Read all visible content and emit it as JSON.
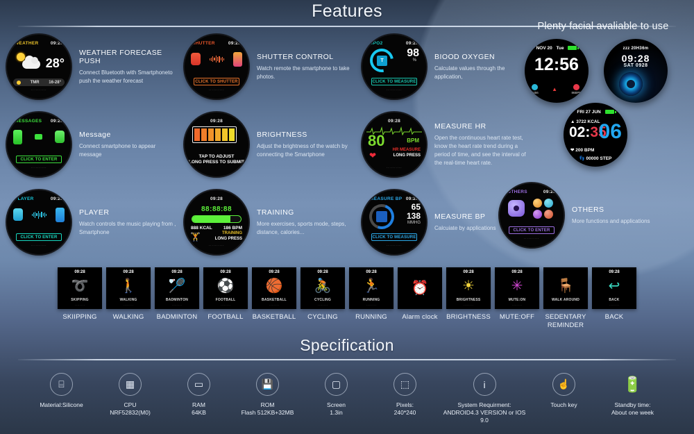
{
  "sections": {
    "features_title": "Features",
    "spec_title": "Specification",
    "facial_title": "Plenty facial avaliable to use"
  },
  "features": [
    {
      "id": "weather",
      "title": "WEATHER FORECASE PUSH",
      "desc": "Connect Bluetooth with Smartphoneto push the weather forecast",
      "watch": {
        "label": "WEATHER",
        "label_color": "#e8c02a",
        "time": "09:28",
        "value": "28°",
        "sub_left": "TMR",
        "sub_right": "16-28°"
      }
    },
    {
      "id": "shutter",
      "title": "SHUTTER CONTROL",
      "desc": "Watch remote the smartphone to take photos.",
      "watch": {
        "label": "SHUTTER",
        "label_color": "#e8552a",
        "time": "09:28",
        "button": "CLICK TO SHUTTER",
        "button_color": "#e8722a"
      }
    },
    {
      "id": "blood-oxygen",
      "title": "BIOOD OXYGEN",
      "desc": "Calculate values through the application,",
      "watch": {
        "label": "SPO2",
        "label_color": "#17c4bd",
        "time": "09:28",
        "value": "98",
        "unit": "%",
        "button": "CLICK TO MEASURE",
        "button_color": "#18c8b0"
      }
    },
    {
      "id": "message",
      "title": "Message",
      "desc": "Connect smartphone to appear message",
      "watch": {
        "label": "MESSAGES",
        "label_color": "#3ce03c",
        "time": "09:28",
        "button": "CLICK TO ENTER",
        "button_color": "#3ce03c"
      }
    },
    {
      "id": "brightness",
      "title": "BRIGHTNESS",
      "desc": "Adjust the brightness of the watch by connecting the Smartphone",
      "watch": {
        "label": "",
        "time": "09:28",
        "hint_line1": "TAP TO ADJUST",
        "hint_line2": "LONG PRESS TO SUBMIT"
      }
    },
    {
      "id": "measure-hr",
      "title": "MEASURE HR",
      "desc": "Open the continuous heart rate test, know the heart rate trend during a period of time, and see the interval of the real-time heart rate.",
      "watch": {
        "label": "",
        "time": "09:28",
        "value": "80",
        "unit": "BPM",
        "hint_line1": "HR MEASURE",
        "hint_line2": "LONG PRESS"
      }
    },
    {
      "id": "player",
      "title": "PLAYER",
      "desc": "Watch controls the music playing from ,  Smartphone",
      "watch": {
        "label": "PLAYER",
        "label_color": "#17c4d8",
        "time": "09:28",
        "button": "CLICK TO ENTER",
        "button_color": "#17d8c0"
      }
    },
    {
      "id": "training",
      "title": "TRAINING",
      "desc": "More exercises, sports mode, steps, distance, calories...",
      "watch": {
        "label": "",
        "time": "09:28",
        "value": "88:88:88",
        "stat_left": "888 KCAL",
        "stat_right": "186 BPM",
        "hint_line1": "TRAINING",
        "hint_line2": "LONG PRESS"
      }
    },
    {
      "id": "measure-bp",
      "title": "MEASURE BP",
      "desc": "Calcuiate by applications",
      "watch": {
        "label": "MEASURE BP",
        "label_color": "#2ba8e8",
        "time": "09:28",
        "value_top": "65",
        "value_bottom": "138",
        "unit": "MMHG",
        "button": "CLICK TO MEASURE",
        "button_color": "#2ba8e8"
      }
    },
    {
      "id": "others",
      "title": "OTHERS",
      "desc": "More functions and applications",
      "watch": {
        "label": "OTHERS",
        "label_color": "#9b6ee0",
        "time": "09:28",
        "button": "CLICK TO ENTER",
        "button_color": "#9b6ee0"
      }
    }
  ],
  "facial_faces": [
    {
      "id": "face-digital",
      "date": "NOV 20",
      "weekday": "Tue",
      "time": "12:56",
      "stat_steps": "3456",
      "stat_bpm": "86BPM"
    },
    {
      "id": "face-space",
      "sleep": "zzz 20H36m",
      "time": "09:28",
      "date": "SAT 0928"
    },
    {
      "id": "face-sport",
      "date": "FRI 27 JUN",
      "kcal": "3722 KCAL",
      "time_left": "02:",
      "time_mid": "35",
      "time_right": "06",
      "bpm": "200 BPM",
      "steps": "00000 STEP"
    }
  ],
  "sports": [
    {
      "id": "skipping",
      "tile_time": "09:28",
      "tile_name": "SKIPPING",
      "label": "SKIIPPING",
      "glyph": "➰",
      "color": "#c448d8"
    },
    {
      "id": "walking",
      "tile_time": "09:28",
      "tile_name": "WALKING",
      "label": "WALKING",
      "glyph": "🚶",
      "color": "#e8e8e8"
    },
    {
      "id": "badminton",
      "tile_time": "09:28",
      "tile_name": "BADMINTON",
      "label": "BADMINTON",
      "glyph": "🏸",
      "color": "#f0f0f0"
    },
    {
      "id": "football",
      "tile_time": "09:28",
      "tile_name": "FOOTBALL",
      "label": "FOOTBALL",
      "glyph": "⚽",
      "color": "#ffffff"
    },
    {
      "id": "basketball",
      "tile_time": "09:28",
      "tile_name": "BASKETBALL",
      "label": "BASKETBALL",
      "glyph": "🏀",
      "color": "#e2722a"
    },
    {
      "id": "cycling",
      "tile_time": "09:28",
      "tile_name": "CYCLING",
      "label": "CYCLING",
      "glyph": "🚴",
      "color": "#e8984a"
    },
    {
      "id": "running",
      "tile_time": "09:28",
      "tile_name": "RUNNING",
      "label": "RUNNING",
      "glyph": "🏃",
      "color": "#3a5ce0"
    },
    {
      "id": "alarm",
      "tile_time": "",
      "tile_name": "",
      "label": "Alarm clock",
      "glyph": "⏰",
      "color": "#dddddd"
    },
    {
      "id": "brightness",
      "tile_time": "09:28",
      "tile_name": "BRIGHTNESS",
      "label": "BRIGHTNESS",
      "glyph": "☀",
      "color": "#f0d23c"
    },
    {
      "id": "mute",
      "tile_time": "09:28",
      "tile_name": "MUTE:ON",
      "label": "MUTE:OFF",
      "glyph": "✳",
      "color": "#d648d8"
    },
    {
      "id": "sedentary",
      "tile_time": "",
      "tile_name": "WALK AROUND",
      "label": "SEDENTARY REMINDER",
      "glyph": "🪑",
      "color": "#e08a3a"
    },
    {
      "id": "back",
      "tile_time": "09:28",
      "tile_name": "BACK",
      "label": "BACK",
      "glyph": "↩",
      "color": "#3ad8c0"
    }
  ],
  "spec_items": [
    {
      "id": "material",
      "icon": "phone-body-icon",
      "glyph": "⌸",
      "line1": "Material:Silicone",
      "line2": ""
    },
    {
      "id": "cpu",
      "icon": "chip-icon",
      "glyph": "▦",
      "line1": "CPU",
      "line2": "NRF52832(M0)"
    },
    {
      "id": "ram",
      "icon": "ram-icon",
      "glyph": "▭",
      "line1": "RAM",
      "line2": "64KB"
    },
    {
      "id": "rom",
      "icon": "save-disk-icon",
      "glyph": "💾",
      "line1": "ROM",
      "line2": "Flash 512KB+32MB"
    },
    {
      "id": "screen",
      "icon": "screen-icon",
      "glyph": "▢",
      "line1": "Screen",
      "line2": "1.3in"
    },
    {
      "id": "pixels",
      "icon": "pixels-icon",
      "glyph": "⬚",
      "line1": "Pixels:",
      "line2": "240*240"
    },
    {
      "id": "system",
      "icon": "info-icon",
      "glyph": "i",
      "line1": "System Requirment:",
      "line2": "ANDROID4.3 VERSION or IOS 9.0"
    },
    {
      "id": "touchkey",
      "icon": "touch-icon",
      "glyph": "☝",
      "line1": "Touch key",
      "line2": ""
    },
    {
      "id": "standby",
      "icon": "battery-icon",
      "glyph": "🔋",
      "line1": "Standby time:",
      "line2": "About one week"
    }
  ]
}
